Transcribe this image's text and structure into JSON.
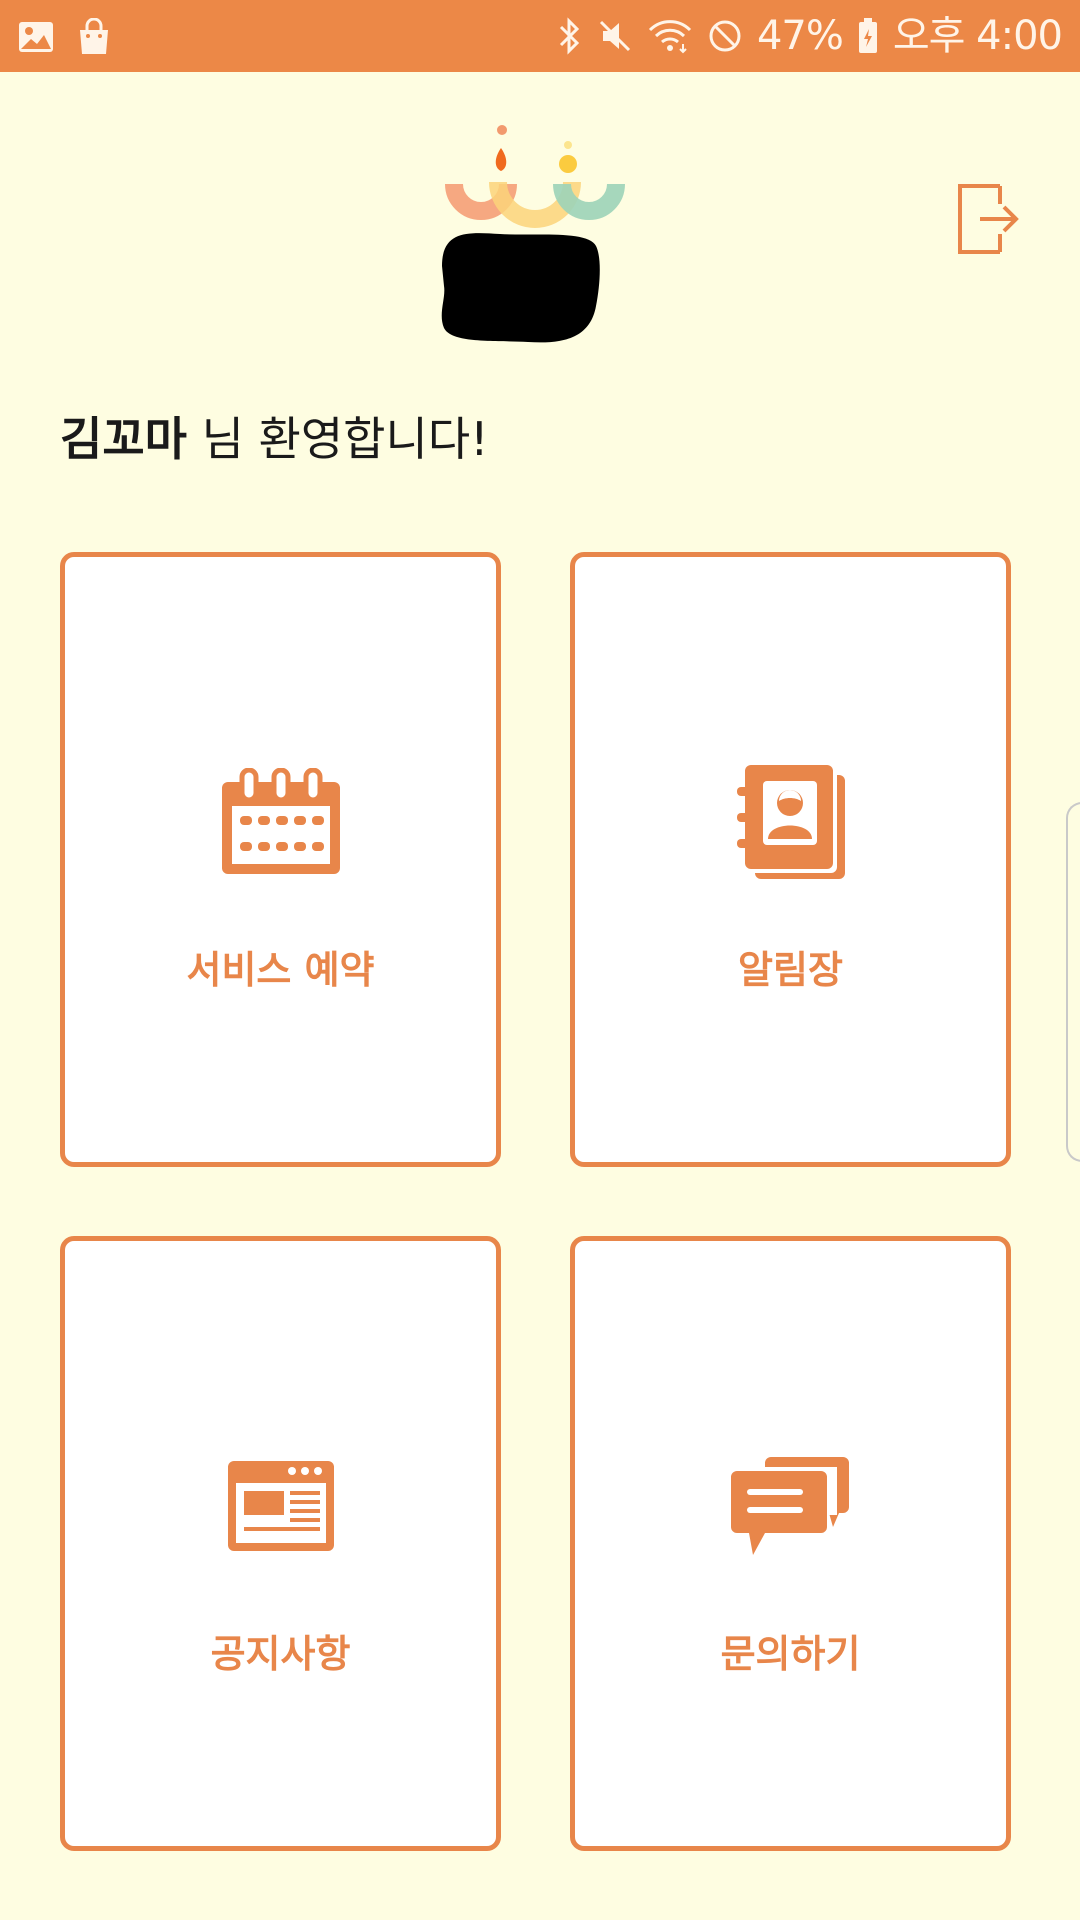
{
  "status_bar": {
    "battery": "47%",
    "time": "오후 4:00",
    "left_icons": [
      "gallery-icon",
      "shopping-bag-icon"
    ],
    "right_icons": [
      "bluetooth-icon",
      "mute-icon",
      "wifi-icon",
      "do-not-disturb-icon",
      "battery-icon"
    ]
  },
  "header": {
    "logo_icon": "app-logo",
    "logout_icon": "logout-icon"
  },
  "welcome": {
    "user_name": "김꼬마",
    "message": " 님 환영합니다!"
  },
  "menu": {
    "items": [
      {
        "label": "서비스 예약",
        "icon": "calendar-icon"
      },
      {
        "label": "알림장",
        "icon": "contact-book-icon"
      },
      {
        "label": "공지사항",
        "icon": "news-browser-icon"
      },
      {
        "label": "문의하기",
        "icon": "chat-bubbles-icon"
      }
    ]
  },
  "colors": {
    "accent": "#E8864A",
    "status_bar": "#EC8847",
    "background": "#FEFDE1",
    "card_background": "#FFFFFF"
  }
}
